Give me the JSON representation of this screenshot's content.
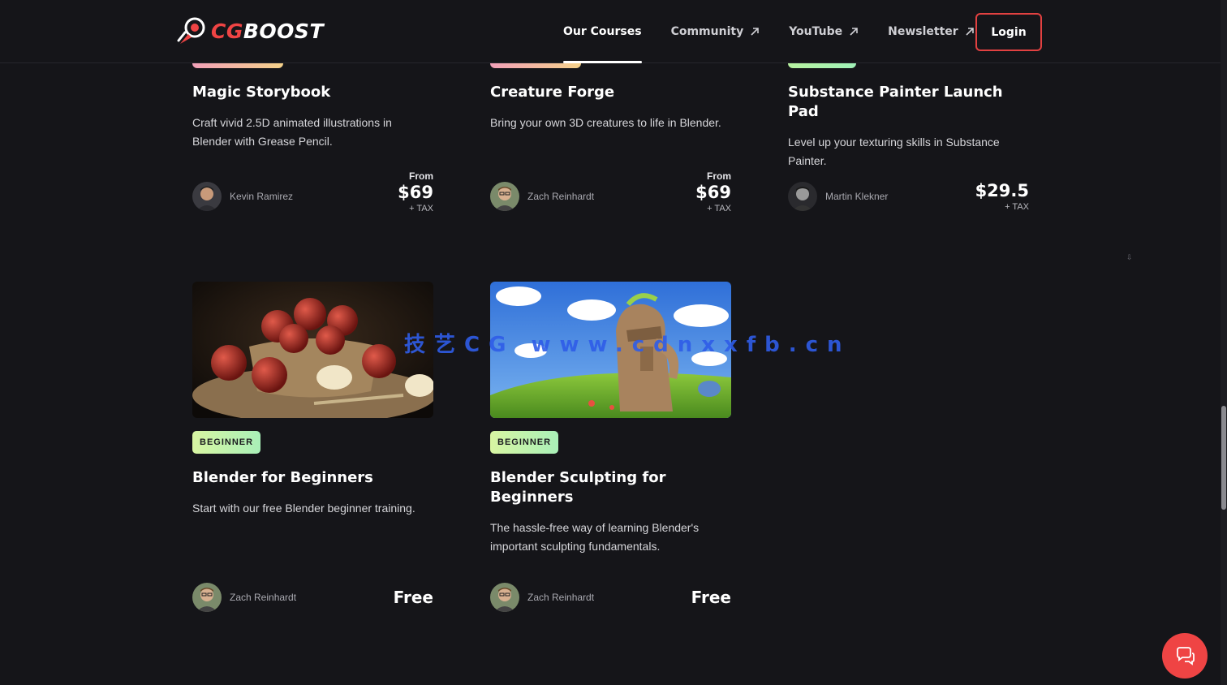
{
  "brand": {
    "cg": "CG",
    "boost": "BOOST"
  },
  "nav": {
    "items": [
      {
        "label": "Our Courses",
        "active": true,
        "external": false
      },
      {
        "label": "Community",
        "active": false,
        "external": true
      },
      {
        "label": "YouTube",
        "active": false,
        "external": true
      },
      {
        "label": "Newsletter",
        "active": false,
        "external": true
      }
    ],
    "login": "Login"
  },
  "courses_top": [
    {
      "title": "Magic Storybook",
      "desc": "Craft vivid 2.5D animated illustrations in Blender with Grease Pencil.",
      "author": "Kevin Ramirez",
      "from": "From",
      "price": "$69",
      "tax": "+ TAX"
    },
    {
      "title": "Creature Forge",
      "desc": "Bring your own 3D creatures to life in Blender.",
      "author": "Zach Reinhardt",
      "from": "From",
      "price": "$69",
      "tax": "+ TAX"
    },
    {
      "title": "Substance Painter Launch Pad",
      "desc": "Level up your texturing skills in Substance Painter.",
      "author": "Martin Klekner",
      "from": "",
      "price": "$29.5",
      "tax": "+ TAX"
    }
  ],
  "courses_bottom": [
    {
      "badge": "BEGINNER",
      "title": "Blender for Beginners",
      "desc": "Start with our free Blender beginner training.",
      "author": "Zach Reinhardt",
      "price": "Free"
    },
    {
      "badge": "BEGINNER",
      "title": "Blender Sculpting for Beginners",
      "desc": "The hassle-free way of learning Blender's important sculpting fundamentals.",
      "author": "Zach Reinhardt",
      "price": "Free"
    }
  ],
  "watermark": "技艺CG www.cdnxxfb.cn",
  "colors": {
    "accent": "#ef4444",
    "background": "#151519",
    "badge": "#c8f5a8"
  },
  "icons": {
    "external": "arrow-up-right-icon",
    "chat": "chat-bubble-icon"
  }
}
